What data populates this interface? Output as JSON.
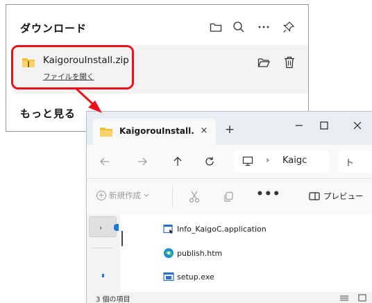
{
  "downloads": {
    "title": "ダウンロード",
    "icons": [
      "folder-icon",
      "search-icon",
      "more-icon",
      "pin-icon"
    ],
    "item": {
      "filename": "KaigorouInstall.zip",
      "open_link": "ファイルを開く",
      "icons": [
        "folder-open-icon",
        "trash-icon"
      ]
    },
    "more_label": "もっと見る"
  },
  "explorer": {
    "tab_title": "KaigorouInstall.",
    "tab_close": "×",
    "new_tab": "+",
    "address_separator": "›",
    "address_text": "Kaigc",
    "search_text": "ト",
    "new_button": "新規作成",
    "more_dots": "•••",
    "preview_button": "プレビュー",
    "files": [
      {
        "name": "Info_KaigoC.application",
        "icon": "application-file-icon"
      },
      {
        "name": "publish.htm",
        "icon": "edge-icon"
      },
      {
        "name": "setup.exe",
        "icon": "exe-file-icon"
      }
    ],
    "status_text": "3 個の項目"
  },
  "colors": {
    "callout_red": "#e8111a",
    "folder_yellow": "#f0c038",
    "accent_blue": "#1e78d8"
  }
}
